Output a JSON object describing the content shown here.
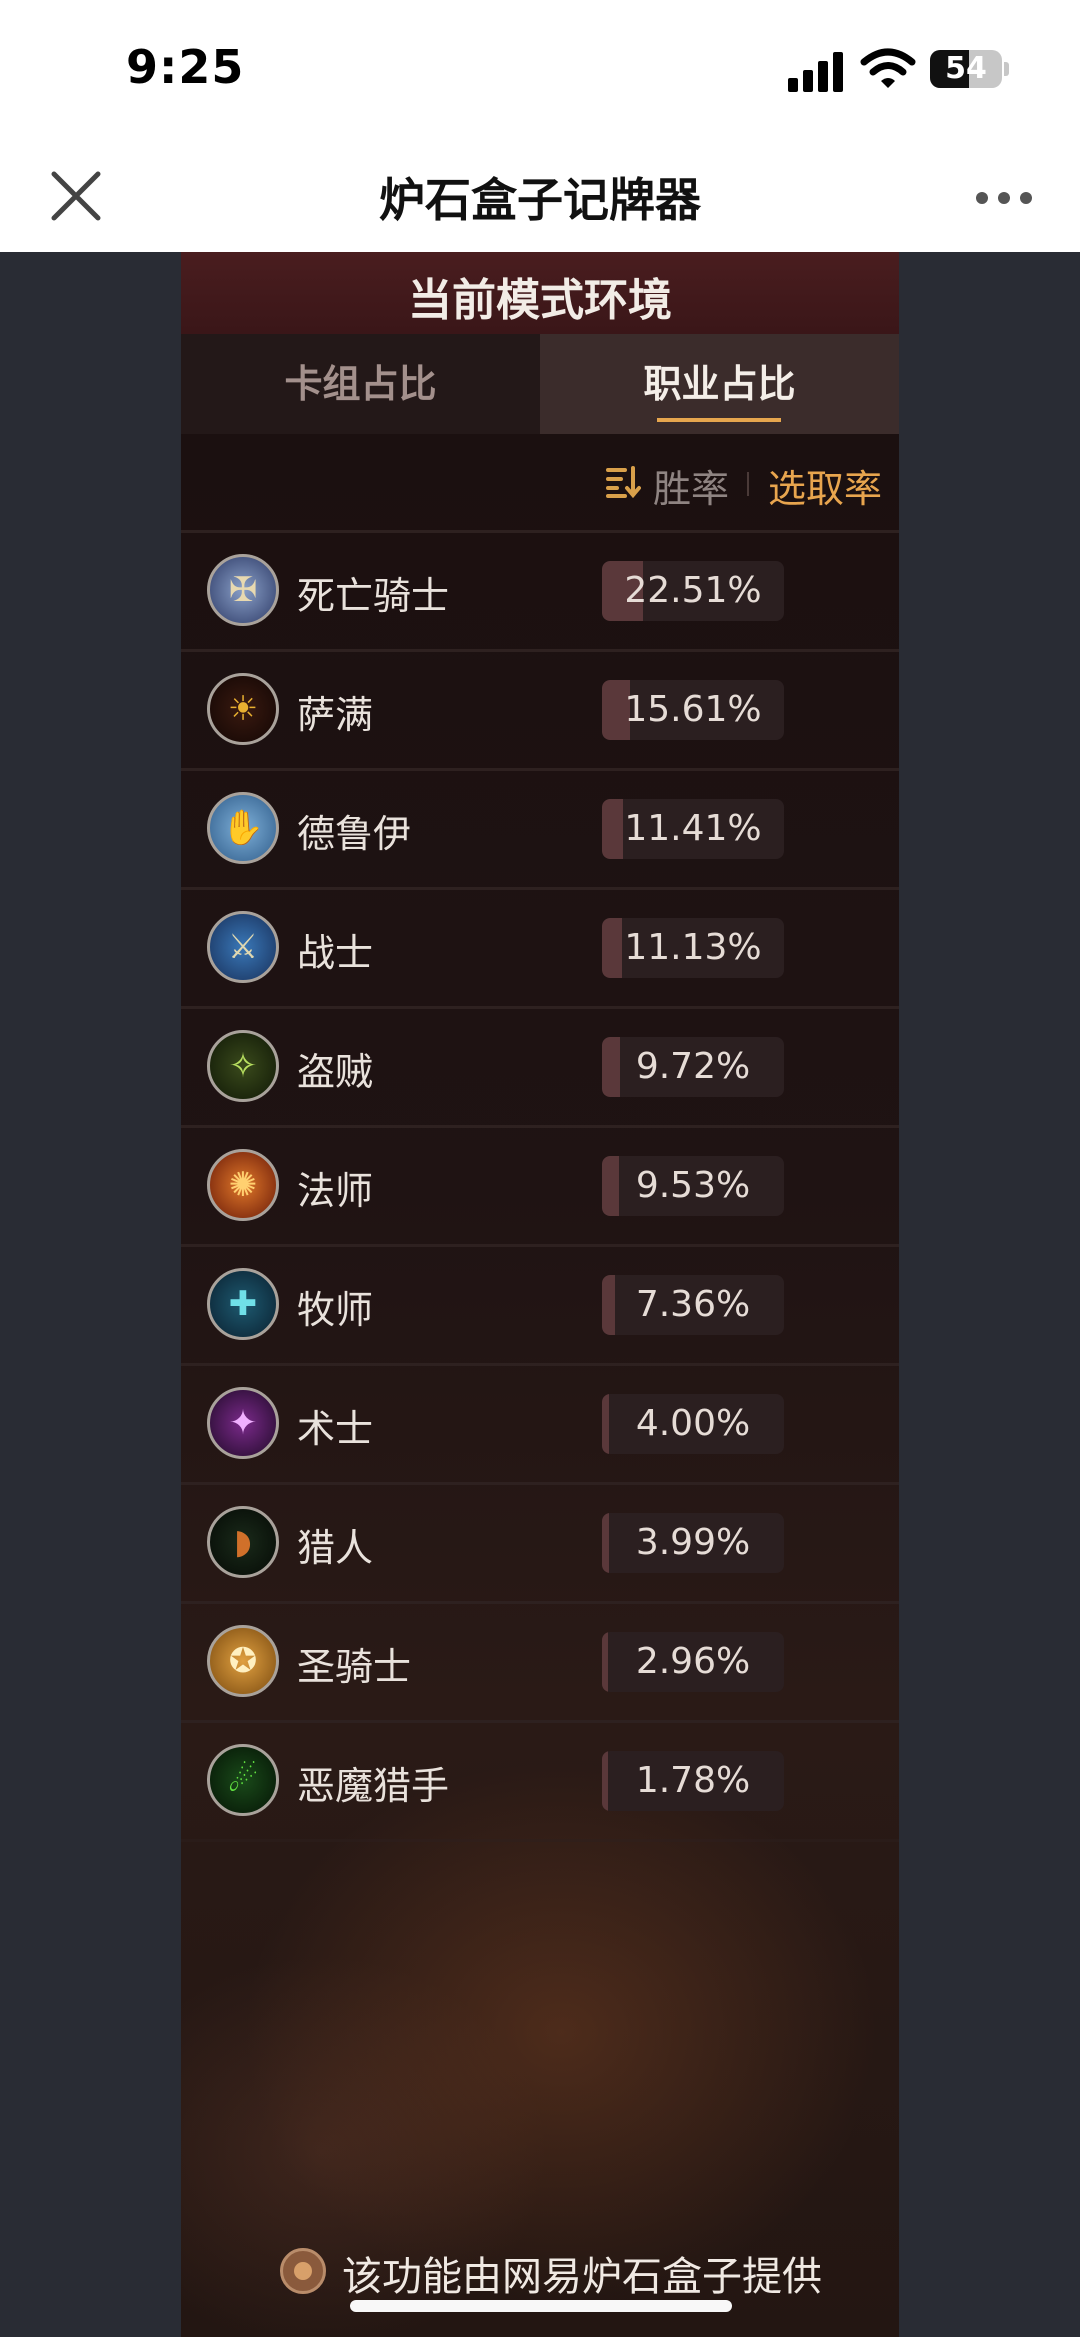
{
  "status_bar": {
    "time": "9:25",
    "battery": "54"
  },
  "nav": {
    "title": "炉石盒子记牌器"
  },
  "panel": {
    "title": "当前模式环境",
    "tabs": [
      {
        "label": "卡组占比"
      },
      {
        "label": "职业占比"
      }
    ],
    "active_tab": "职业占比",
    "sort": {
      "winrate": "胜率",
      "pickrate": "选取率",
      "active": "选取率"
    }
  },
  "classes": [
    {
      "name": "死亡骑士",
      "pct": "22.51%",
      "value": 22.51,
      "icon": "death-knight-icon"
    },
    {
      "name": "萨满",
      "pct": "15.61%",
      "value": 15.61,
      "icon": "shaman-icon"
    },
    {
      "name": "德鲁伊",
      "pct": "11.41%",
      "value": 11.41,
      "icon": "druid-icon"
    },
    {
      "name": "战士",
      "pct": "11.13%",
      "value": 11.13,
      "icon": "warrior-icon"
    },
    {
      "name": "盗贼",
      "pct": "9.72%",
      "value": 9.72,
      "icon": "rogue-icon"
    },
    {
      "name": "法师",
      "pct": "9.53%",
      "value": 9.53,
      "icon": "mage-icon"
    },
    {
      "name": "牧师",
      "pct": "7.36%",
      "value": 7.36,
      "icon": "priest-icon"
    },
    {
      "name": "术士",
      "pct": "4.00%",
      "value": 4.0,
      "icon": "warlock-icon"
    },
    {
      "name": "猎人",
      "pct": "3.99%",
      "value": 3.99,
      "icon": "hunter-icon"
    },
    {
      "name": "圣骑士",
      "pct": "2.96%",
      "value": 2.96,
      "icon": "paladin-icon"
    },
    {
      "name": "恶魔猎手",
      "pct": "1.78%",
      "value": 1.78,
      "icon": "demon-hunter-icon"
    }
  ],
  "footer": {
    "text": "该功能由网易炉石盒子提供"
  }
}
